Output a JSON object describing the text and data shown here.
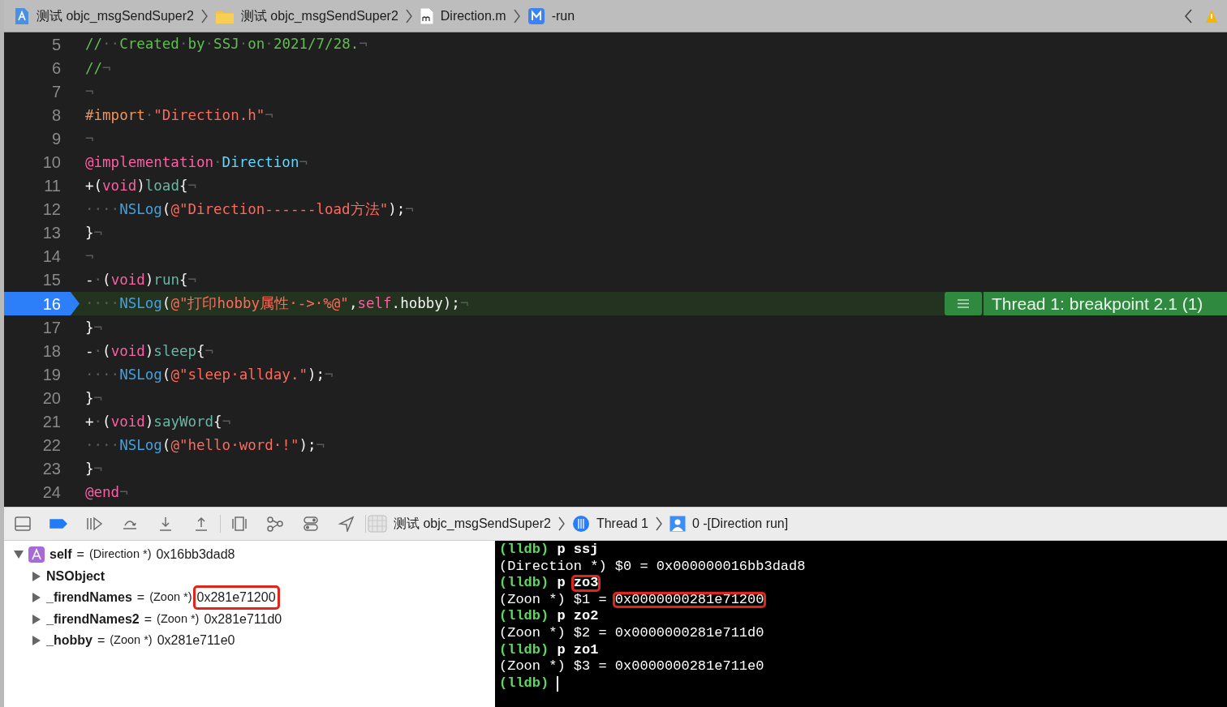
{
  "breadcrumb": [
    {
      "kind": "app",
      "label": "测试 objc_msgSendSuper2"
    },
    {
      "kind": "folder",
      "label": "测试 objc_msgSendSuper2"
    },
    {
      "kind": "mfile",
      "label": "Direction.m"
    },
    {
      "kind": "method",
      "label": "-run"
    }
  ],
  "code_lines": [
    {
      "number": "5",
      "current": false,
      "tokens": [
        {
          "kind": "comment",
          "text": "//"
        },
        {
          "kind": "ws",
          "text": "··"
        },
        {
          "kind": "comment",
          "text": "Created"
        },
        {
          "kind": "ws",
          "text": "·"
        },
        {
          "kind": "comment",
          "text": "by"
        },
        {
          "kind": "ws",
          "text": "·"
        },
        {
          "kind": "comment",
          "text": "SSJ"
        },
        {
          "kind": "ws",
          "text": "·"
        },
        {
          "kind": "comment",
          "text": "on"
        },
        {
          "kind": "ws",
          "text": "·"
        },
        {
          "kind": "comment",
          "text": "2021/7/28."
        },
        {
          "kind": "ws",
          "text": "¬"
        }
      ]
    },
    {
      "number": "6",
      "current": false,
      "tokens": [
        {
          "kind": "comment",
          "text": "//"
        },
        {
          "kind": "ws",
          "text": "¬"
        }
      ]
    },
    {
      "number": "7",
      "current": false,
      "tokens": [
        {
          "kind": "ws",
          "text": "¬"
        }
      ]
    },
    {
      "number": "8",
      "current": false,
      "tokens": [
        {
          "kind": "preproc",
          "text": "#import"
        },
        {
          "kind": "ws",
          "text": "·"
        },
        {
          "kind": "string",
          "text": "\"Direction.h\""
        },
        {
          "kind": "ws",
          "text": "¬"
        }
      ]
    },
    {
      "number": "9",
      "current": false,
      "tokens": [
        {
          "kind": "ws",
          "text": "¬"
        }
      ]
    },
    {
      "number": "10",
      "current": false,
      "tokens": [
        {
          "kind": "keyword",
          "text": "@implementation"
        },
        {
          "kind": "ws",
          "text": "·"
        },
        {
          "kind": "class",
          "text": "Direction"
        },
        {
          "kind": "ws",
          "text": "¬"
        }
      ]
    },
    {
      "number": "11",
      "current": false,
      "tokens": [
        {
          "kind": "plain",
          "text": "+("
        },
        {
          "kind": "keyword",
          "text": "void"
        },
        {
          "kind": "plain",
          "text": ")"
        },
        {
          "kind": "method",
          "text": "load"
        },
        {
          "kind": "plain",
          "text": "{"
        },
        {
          "kind": "ws",
          "text": "¬"
        }
      ]
    },
    {
      "number": "12",
      "current": false,
      "tokens": [
        {
          "kind": "ws",
          "text": "····"
        },
        {
          "kind": "function",
          "text": "NSLog"
        },
        {
          "kind": "plain",
          "text": "("
        },
        {
          "kind": "string",
          "text": "@\"Direction------load方法\""
        },
        {
          "kind": "plain",
          "text": ");"
        },
        {
          "kind": "ws",
          "text": "¬"
        }
      ]
    },
    {
      "number": "13",
      "current": false,
      "tokens": [
        {
          "kind": "plain",
          "text": "}"
        },
        {
          "kind": "ws",
          "text": "¬"
        }
      ]
    },
    {
      "number": "14",
      "current": false,
      "tokens": [
        {
          "kind": "ws",
          "text": "¬"
        }
      ]
    },
    {
      "number": "15",
      "current": false,
      "tokens": [
        {
          "kind": "plain",
          "text": "-"
        },
        {
          "kind": "ws",
          "text": "·"
        },
        {
          "kind": "plain",
          "text": "("
        },
        {
          "kind": "keyword",
          "text": "void"
        },
        {
          "kind": "plain",
          "text": ")"
        },
        {
          "kind": "method",
          "text": "run"
        },
        {
          "kind": "plain",
          "text": "{"
        },
        {
          "kind": "ws",
          "text": "¬"
        }
      ]
    },
    {
      "number": "16",
      "current": true,
      "tokens": [
        {
          "kind": "ws",
          "text": "····"
        },
        {
          "kind": "function",
          "text": "NSLog"
        },
        {
          "kind": "plain",
          "text": "("
        },
        {
          "kind": "string",
          "text": "@\"打印hobby属性·->·%@\""
        },
        {
          "kind": "plain",
          "text": ","
        },
        {
          "kind": "keyword",
          "text": "self"
        },
        {
          "kind": "plain",
          "text": ".hobby);"
        },
        {
          "kind": "ws",
          "text": "¬"
        }
      ]
    },
    {
      "number": "17",
      "current": false,
      "tokens": [
        {
          "kind": "plain",
          "text": "}"
        },
        {
          "kind": "ws",
          "text": "¬"
        }
      ]
    },
    {
      "number": "18",
      "current": false,
      "tokens": [
        {
          "kind": "plain",
          "text": "-"
        },
        {
          "kind": "ws",
          "text": "·"
        },
        {
          "kind": "plain",
          "text": "("
        },
        {
          "kind": "keyword",
          "text": "void"
        },
        {
          "kind": "plain",
          "text": ")"
        },
        {
          "kind": "method",
          "text": "sleep"
        },
        {
          "kind": "plain",
          "text": "{"
        },
        {
          "kind": "ws",
          "text": "¬"
        }
      ]
    },
    {
      "number": "19",
      "current": false,
      "tokens": [
        {
          "kind": "ws",
          "text": "····"
        },
        {
          "kind": "function",
          "text": "NSLog"
        },
        {
          "kind": "plain",
          "text": "("
        },
        {
          "kind": "string",
          "text": "@\"sleep·allday.\""
        },
        {
          "kind": "plain",
          "text": ");"
        },
        {
          "kind": "ws",
          "text": "¬"
        }
      ]
    },
    {
      "number": "20",
      "current": false,
      "tokens": [
        {
          "kind": "plain",
          "text": "}"
        },
        {
          "kind": "ws",
          "text": "¬"
        }
      ]
    },
    {
      "number": "21",
      "current": false,
      "tokens": [
        {
          "kind": "plain",
          "text": "+"
        },
        {
          "kind": "ws",
          "text": "·"
        },
        {
          "kind": "plain",
          "text": "("
        },
        {
          "kind": "keyword",
          "text": "void"
        },
        {
          "kind": "plain",
          "text": ")"
        },
        {
          "kind": "method",
          "text": "sayWord"
        },
        {
          "kind": "plain",
          "text": "{"
        },
        {
          "kind": "ws",
          "text": "¬"
        }
      ]
    },
    {
      "number": "22",
      "current": false,
      "tokens": [
        {
          "kind": "ws",
          "text": "····"
        },
        {
          "kind": "function",
          "text": "NSLog"
        },
        {
          "kind": "plain",
          "text": "("
        },
        {
          "kind": "string",
          "text": "@\"hello·word·!\""
        },
        {
          "kind": "plain",
          "text": ");"
        },
        {
          "kind": "ws",
          "text": "¬"
        }
      ]
    },
    {
      "number": "23",
      "current": false,
      "tokens": [
        {
          "kind": "plain",
          "text": "}"
        },
        {
          "kind": "ws",
          "text": "¬"
        }
      ]
    },
    {
      "number": "24",
      "current": false,
      "tokens": [
        {
          "kind": "keyword",
          "text": "@end"
        },
        {
          "kind": "ws",
          "text": "¬"
        }
      ]
    }
  ],
  "breakpoint_banner": {
    "label": "Thread 1: breakpoint 2.1 (1)"
  },
  "debug_bar": {
    "breakpoints_active": true,
    "path": [
      {
        "kind": "process",
        "label": "测试 objc_msgSendSuper2"
      },
      {
        "kind": "thread",
        "label": "Thread 1"
      },
      {
        "kind": "frame",
        "label": "0 -[Direction run]"
      }
    ]
  },
  "variables": [
    {
      "name": "self",
      "equals": "=",
      "type": "(Direction *)",
      "value": "0x16bb3dad8",
      "expanded": true,
      "boxed": false,
      "children": [
        {
          "name": "NSObject",
          "expanded": false
        },
        {
          "name": "_firendNames",
          "equals": "=",
          "type": "(Zoon *)",
          "value": "0x281e71200",
          "expanded": false,
          "boxed": true
        },
        {
          "name": "_firendNames2",
          "equals": "=",
          "type": "(Zoon *)",
          "value": "0x281e711d0",
          "expanded": false,
          "boxed": false
        },
        {
          "name": "_hobby",
          "equals": "=",
          "type": "(Zoon *)",
          "value": "0x281e711e0",
          "expanded": false,
          "boxed": false
        }
      ]
    }
  ],
  "console": [
    {
      "kind": "prompt",
      "segments": [
        {
          "text": "(lldb)",
          "boxed": false
        },
        {
          "text": " p ",
          "boxed": false
        },
        {
          "text": "ssj",
          "boxed": false
        }
      ]
    },
    {
      "kind": "output",
      "segments": [
        {
          "text": "(Direction *) $0 = ",
          "boxed": false
        },
        {
          "text": "0x000000016bb3dad8",
          "boxed": false
        }
      ]
    },
    {
      "kind": "prompt",
      "segments": [
        {
          "text": "(lldb)",
          "boxed": false
        },
        {
          "text": " p ",
          "boxed": false
        },
        {
          "text": "zo3",
          "boxed": true
        }
      ]
    },
    {
      "kind": "output",
      "segments": [
        {
          "text": "(Zoon *) $1 = ",
          "boxed": false
        },
        {
          "text": "0x0000000281e71200",
          "boxed": true
        }
      ]
    },
    {
      "kind": "prompt",
      "segments": [
        {
          "text": "(lldb)",
          "boxed": false
        },
        {
          "text": " p ",
          "boxed": false
        },
        {
          "text": "zo2",
          "boxed": false
        }
      ]
    },
    {
      "kind": "output",
      "segments": [
        {
          "text": "(Zoon *) $2 = ",
          "boxed": false
        },
        {
          "text": "0x0000000281e711d0",
          "boxed": false
        }
      ]
    },
    {
      "kind": "prompt",
      "segments": [
        {
          "text": "(lldb)",
          "boxed": false
        },
        {
          "text": " p ",
          "boxed": false
        },
        {
          "text": "zo1",
          "boxed": false
        }
      ]
    },
    {
      "kind": "output",
      "segments": [
        {
          "text": "(Zoon *) $3 = ",
          "boxed": false
        },
        {
          "text": "0x0000000281e711e0",
          "boxed": false
        }
      ]
    },
    {
      "kind": "prompt",
      "cursor": true,
      "segments": [
        {
          "text": "(lldb)",
          "boxed": false
        }
      ]
    }
  ]
}
